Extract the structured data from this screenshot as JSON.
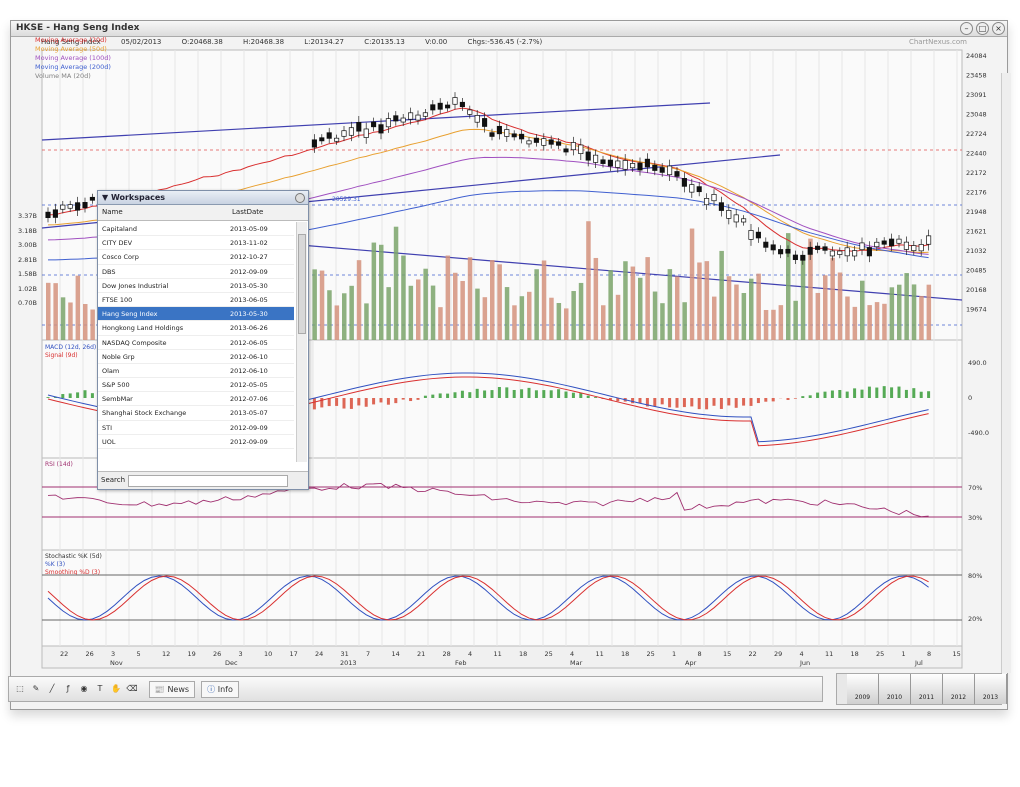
{
  "window": {
    "title": "HKSE - Hang Seng Index"
  },
  "info": {
    "name": "Hang Seng Index",
    "date": "05/02/2013",
    "open": "O:20468.38",
    "high": "H:20468.38",
    "low": "L:20134.27",
    "close": "C:20135.13",
    "volume": "V:0.00",
    "change": "Chgs:-536.45 (-2.7%)",
    "source": "ChartNexus.com"
  },
  "legend": [
    {
      "label": "Moving Average (20d)",
      "color": "#d93030"
    },
    {
      "label": "Moving Average (50d)",
      "color": "#e8a030"
    },
    {
      "label": "Moving Average (100d)",
      "color": "#a050c0"
    },
    {
      "label": "Moving Average (200d)",
      "color": "#4060d0"
    },
    {
      "label": "Volume MA (20d)",
      "color": "#808080"
    }
  ],
  "price_axis": [
    "24084",
    "23458",
    "23091",
    "23048",
    "22724",
    "22440",
    "22172",
    "22176",
    "21948",
    "21621",
    "21032",
    "20485",
    "20168",
    "19674"
  ],
  "left_axis": [
    "3.37B",
    "3.18B",
    "3.00B",
    "2.81B",
    "1.58B",
    "1.02B",
    "0.70B"
  ],
  "macd": {
    "title": "MACD (12d, 26d)",
    "signal": "Signal (9d)",
    "axis": [
      "490.0",
      "0",
      "-490.0"
    ]
  },
  "rsi": {
    "title": "RSI (14d)",
    "axis": [
      "70%",
      "30%"
    ]
  },
  "stoch": {
    "title": "Stochastic %K (5d)",
    "k": "%K (3)",
    "d": "Smoothing %D (3)",
    "axis": [
      "80%",
      "20%"
    ]
  },
  "trend_label": "20529.31",
  "xaxis": {
    "days": [
      "22",
      "26",
      "3",
      "5",
      "12",
      "19",
      "26",
      "3",
      "10",
      "17",
      "24",
      "31",
      "7",
      "14",
      "21",
      "28",
      "4",
      "11",
      "18",
      "25",
      "4",
      "11",
      "18",
      "25",
      "1",
      "8",
      "15",
      "22",
      "29",
      "4",
      "11",
      "18",
      "25",
      "1",
      "8",
      "15"
    ],
    "months": [
      "Nov",
      "Dec",
      "2013",
      "Feb",
      "Mar",
      "Apr",
      "Jun",
      "Jul"
    ]
  },
  "watchlist": {
    "title": "Workspaces",
    "col_name": "Name",
    "col_date": "LastDate",
    "rows": [
      {
        "name": "Capitaland",
        "date": "2013-05-09"
      },
      {
        "name": "CITY DEV",
        "date": "2013-11-02"
      },
      {
        "name": "Cosco Corp",
        "date": "2012-10-27"
      },
      {
        "name": "DBS",
        "date": "2012-09-09"
      },
      {
        "name": "Dow Jones Industrial",
        "date": "2013-05-30"
      },
      {
        "name": "FTSE 100",
        "date": "2013-06-05"
      },
      {
        "name": "Hang Seng Index",
        "date": "2013-05-30"
      },
      {
        "name": "Hongkong Land Holdings",
        "date": "2013-06-26"
      },
      {
        "name": "NASDAQ Composite",
        "date": "2012-06-05"
      },
      {
        "name": "Noble Grp",
        "date": "2012-06-10"
      },
      {
        "name": "Olam",
        "date": "2012-06-10"
      },
      {
        "name": "S&P 500",
        "date": "2012-05-05"
      },
      {
        "name": "SembMar",
        "date": "2012-07-06"
      },
      {
        "name": "Shanghai Stock Exchange",
        "date": "2013-05-07"
      },
      {
        "name": "STI",
        "date": "2012-09-09"
      },
      {
        "name": "UOL",
        "date": "2012-09-09"
      }
    ],
    "selected": 6,
    "search_label": "Search"
  },
  "toolbar": {
    "btn_news": "News",
    "btn_info": "Info"
  },
  "nav": [
    "2009",
    "2010",
    "2011",
    "2012",
    "2013"
  ]
}
